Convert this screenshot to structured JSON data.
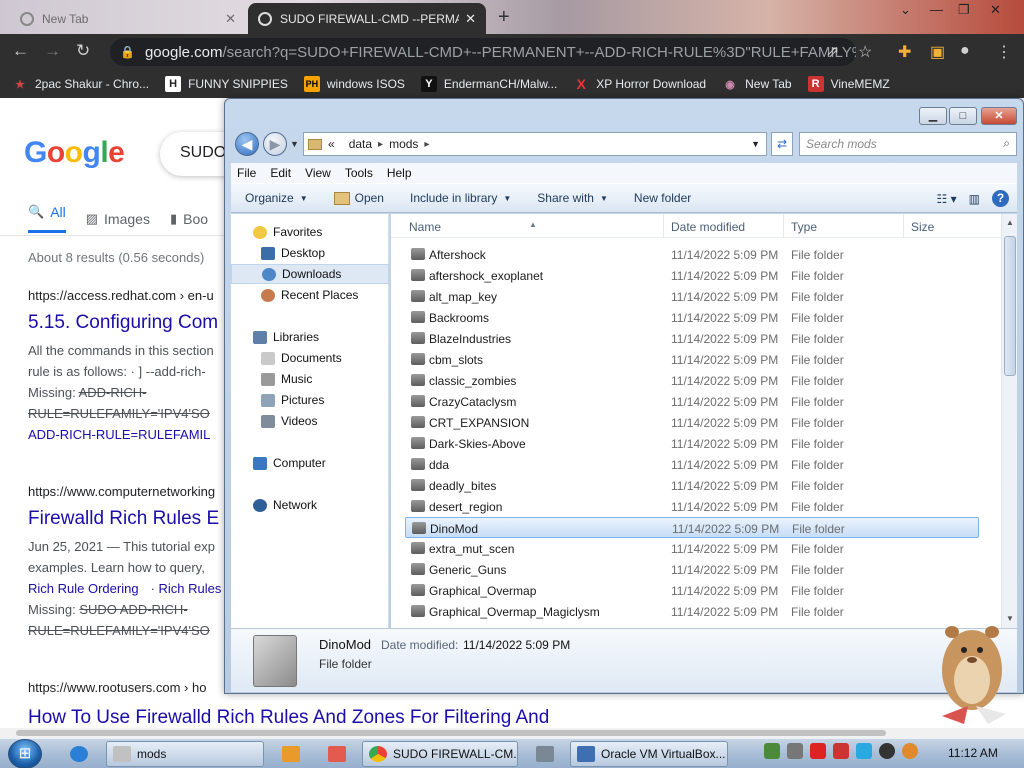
{
  "browser": {
    "tabs": [
      {
        "title": "New Tab"
      },
      {
        "title": "SUDO FIREWALL-CMD --PERMANENT"
      }
    ],
    "url_main": "google.com",
    "url_rest": "/search?q=SUDO+FIREWALL-CMD+--PERMANENT+--ADD-RICH-RULE%3D\"RULE+FAMILY%3D...",
    "bookmarks": [
      {
        "icon": "★",
        "label": "2pac Shakur - Chro...",
        "color": "#c44"
      },
      {
        "icon": "H",
        "label": "FUNNY SNIPPIES",
        "color": "#333"
      },
      {
        "icon": "PH",
        "label": "windows ISOS",
        "color": "#f7a400"
      },
      {
        "icon": "Y",
        "label": "EndermanCH/Malw...",
        "color": "#222"
      },
      {
        "icon": "X",
        "label": "XP Horror Download",
        "color": "#d22"
      },
      {
        "icon": "◉",
        "label": "New Tab",
        "color": "#a47"
      },
      {
        "icon": "R",
        "label": "VineMEMZ",
        "color": "#c33"
      }
    ]
  },
  "google": {
    "logo": "Google",
    "query": "SUDO",
    "tabs": [
      "All",
      "Images",
      "Boo"
    ],
    "stats": "About 8 results (0.56 seconds)",
    "results": [
      {
        "cite": "https://access.redhat.com › en-u",
        "title": "5.15. Configuring Com",
        "snippet1": "All the commands in this section",
        "snippet2": "rule is as follows: · ] --add-rich-",
        "missing_label": "Missing:",
        "missing1": "ADD-RICH-",
        "missing2": "RULE=RULEFAMILY='IPV4'SO",
        "missing3": "ADD-RICH-RULE=RULEFAMIL"
      },
      {
        "cite": "https://www.computernetworking",
        "title": "Firewalld Rich Rules E",
        "snippet1": "Jun 25, 2021 — This tutorial exp",
        "snippet2": "examples. Learn how to query,",
        "link1": "Rich Rule Ordering",
        "link2": "Rich Rules",
        "missing_label": "Missing:",
        "missing1": "SUDO ADD-RICH-",
        "missing2": "RULE=RULEFAMILY='IPV4'SO"
      },
      {
        "cite": "https://www.rootusers.com › ho",
        "title": "How To Use Firewalld Rich Rules And Zones For Filtering And"
      }
    ]
  },
  "explorer": {
    "path": [
      "data",
      "mods"
    ],
    "path_prefix": "«",
    "search_placeholder": "Search mods",
    "menu": [
      "File",
      "Edit",
      "View",
      "Tools",
      "Help"
    ],
    "commands": [
      "Organize",
      "Open",
      "Include in library",
      "Share with",
      "New folder"
    ],
    "nav": {
      "favorites": "Favorites",
      "desktop": "Desktop",
      "downloads": "Downloads",
      "recent": "Recent Places",
      "libraries": "Libraries",
      "documents": "Documents",
      "music": "Music",
      "pictures": "Pictures",
      "videos": "Videos",
      "computer": "Computer",
      "network": "Network"
    },
    "columns": {
      "name": "Name",
      "date": "Date modified",
      "type": "Type",
      "size": "Size"
    },
    "rows": [
      {
        "name": "Aftershock",
        "date": "11/14/2022 5:09 PM",
        "type": "File folder"
      },
      {
        "name": "aftershock_exoplanet",
        "date": "11/14/2022 5:09 PM",
        "type": "File folder"
      },
      {
        "name": "alt_map_key",
        "date": "11/14/2022 5:09 PM",
        "type": "File folder"
      },
      {
        "name": "Backrooms",
        "date": "11/14/2022 5:09 PM",
        "type": "File folder"
      },
      {
        "name": "BlazeIndustries",
        "date": "11/14/2022 5:09 PM",
        "type": "File folder"
      },
      {
        "name": "cbm_slots",
        "date": "11/14/2022 5:09 PM",
        "type": "File folder"
      },
      {
        "name": "classic_zombies",
        "date": "11/14/2022 5:09 PM",
        "type": "File folder"
      },
      {
        "name": "CrazyCataclysm",
        "date": "11/14/2022 5:09 PM",
        "type": "File folder"
      },
      {
        "name": "CRT_EXPANSION",
        "date": "11/14/2022 5:09 PM",
        "type": "File folder"
      },
      {
        "name": "Dark-Skies-Above",
        "date": "11/14/2022 5:09 PM",
        "type": "File folder"
      },
      {
        "name": "dda",
        "date": "11/14/2022 5:09 PM",
        "type": "File folder"
      },
      {
        "name": "deadly_bites",
        "date": "11/14/2022 5:09 PM",
        "type": "File folder"
      },
      {
        "name": "desert_region",
        "date": "11/14/2022 5:09 PM",
        "type": "File folder"
      },
      {
        "name": "DinoMod",
        "date": "11/14/2022 5:09 PM",
        "type": "File folder"
      },
      {
        "name": "extra_mut_scen",
        "date": "11/14/2022 5:09 PM",
        "type": "File folder"
      },
      {
        "name": "Generic_Guns",
        "date": "11/14/2022 5:09 PM",
        "type": "File folder"
      },
      {
        "name": "Graphical_Overmap",
        "date": "11/14/2022 5:09 PM",
        "type": "File folder"
      },
      {
        "name": "Graphical_Overmap_Magiclysm",
        "date": "11/14/2022 5:09 PM",
        "type": "File folder"
      }
    ],
    "selected": "DinoMod",
    "details": {
      "name": "DinoMod",
      "modified_label": "Date modified:",
      "modified_value": "11/14/2022 5:09 PM",
      "type": "File folder"
    }
  },
  "taskbar": {
    "items": [
      {
        "label": "",
        "name": "taskbar-ie"
      },
      {
        "label": "mods",
        "name": "taskbar-explorer-mods"
      },
      {
        "label": "",
        "name": "taskbar-media"
      },
      {
        "label": "",
        "name": "taskbar-paint"
      },
      {
        "label": "SUDO FIREWALL-CM...",
        "name": "taskbar-chrome"
      },
      {
        "label": "",
        "name": "taskbar-calc"
      },
      {
        "label": "Oracle VM VirtualBox...",
        "name": "taskbar-virtualbox"
      }
    ],
    "clock": "11:12 AM"
  },
  "colors": {
    "accent": "#1a73e8",
    "link": "#1a0dab",
    "selection": "#c6ddf7"
  }
}
